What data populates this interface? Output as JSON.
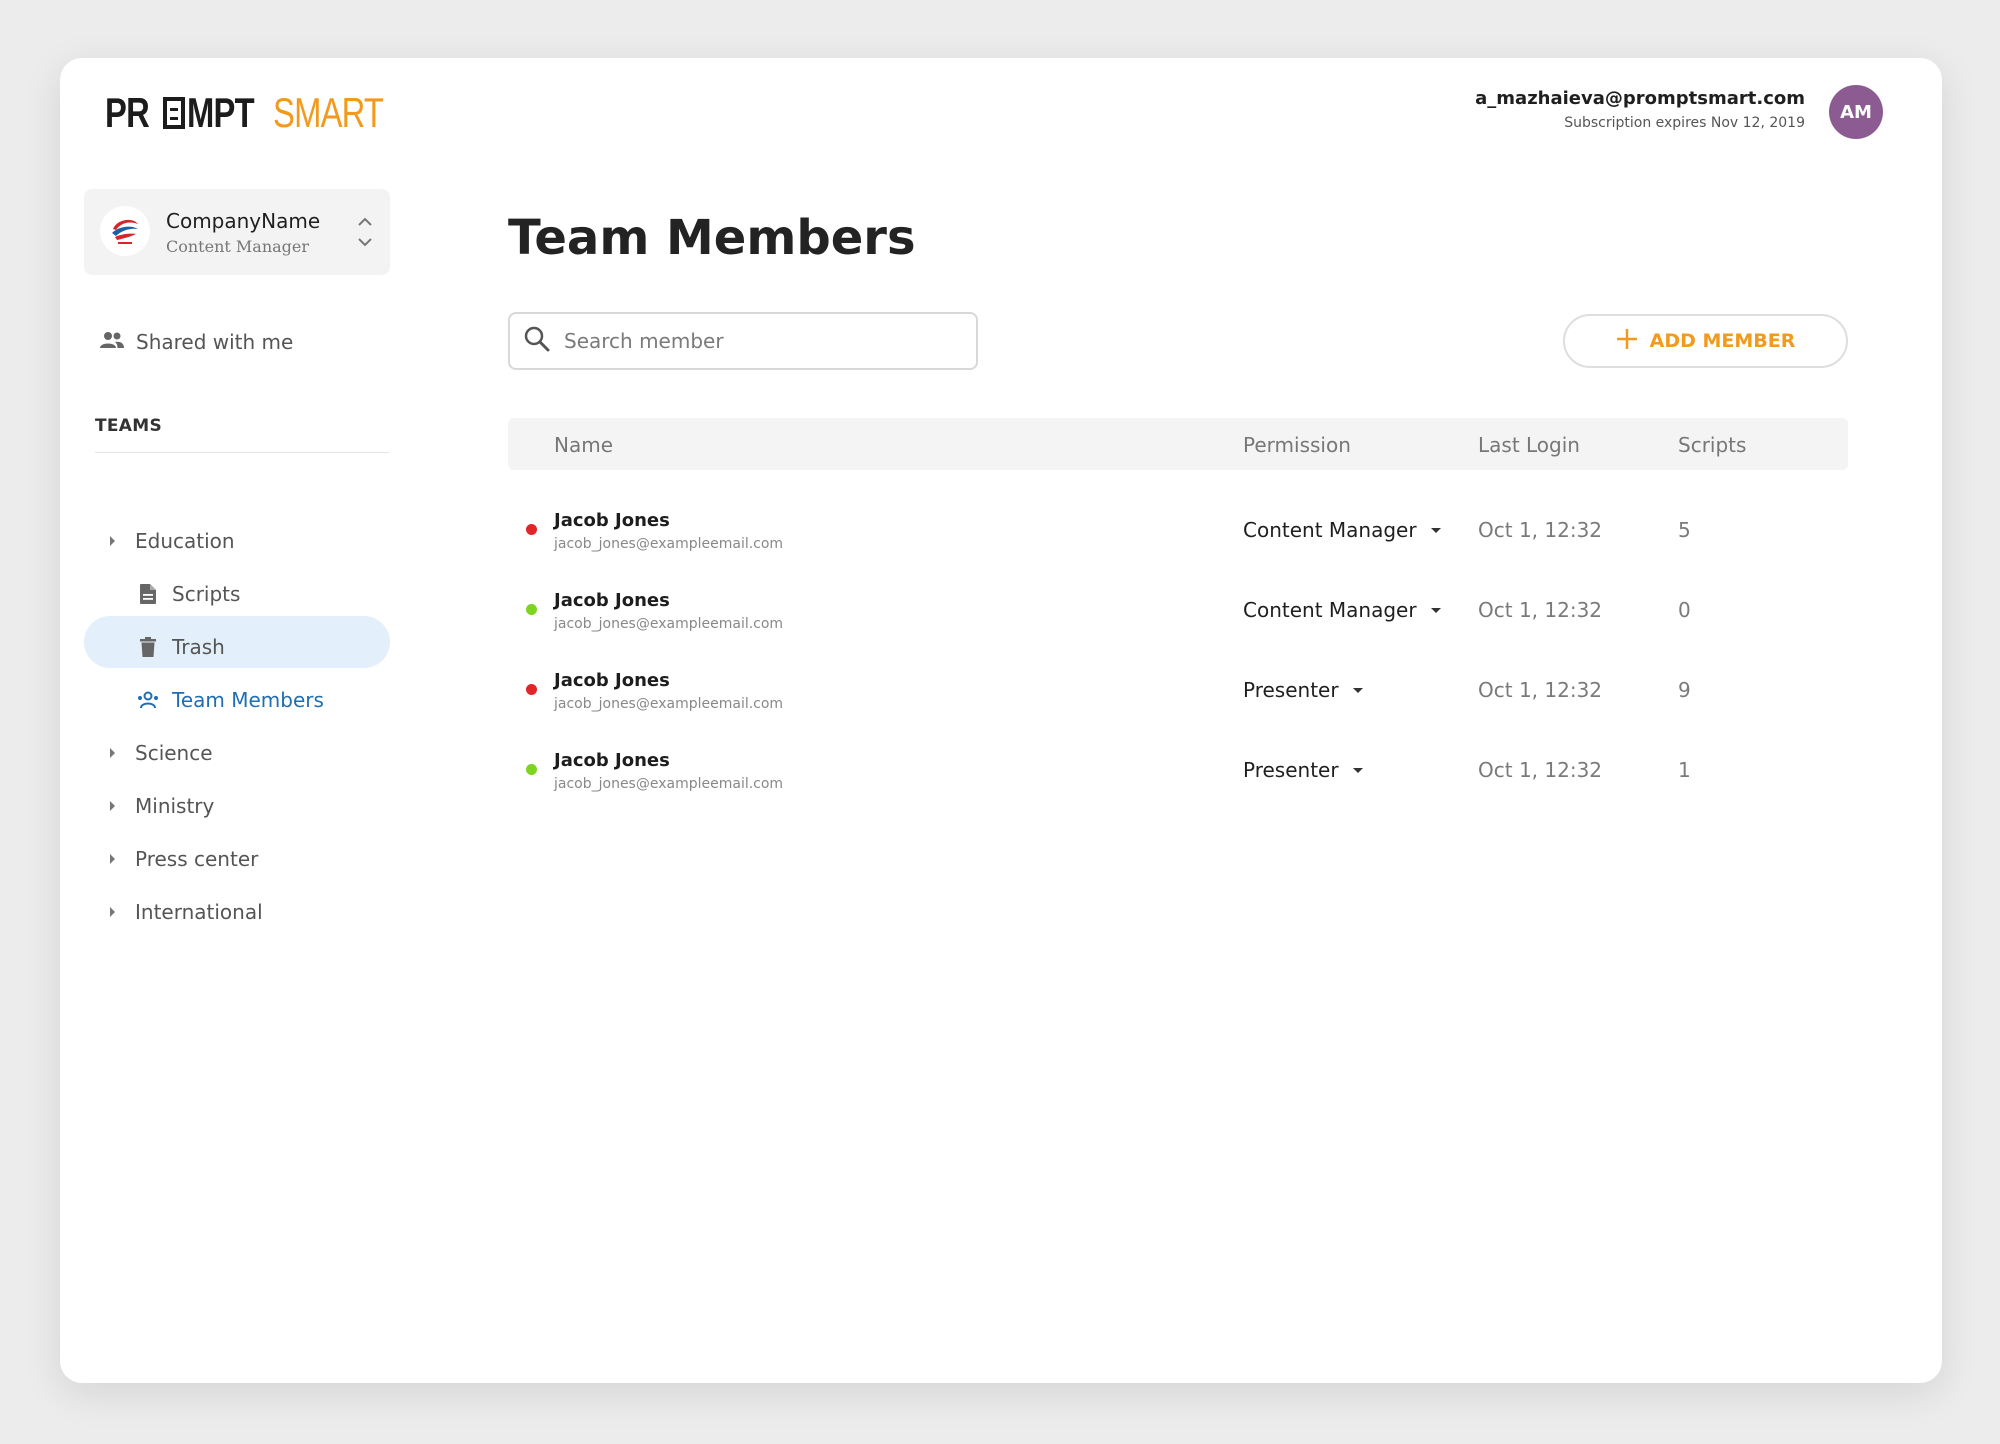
{
  "logo": {
    "part1": "PR",
    "part2": "MPT",
    "part3": "SMART"
  },
  "user": {
    "email": "a_mazhaieva@promptsmart.com",
    "subscription": "Subscription expires Nov 12, 2019",
    "initials": "AM",
    "avatar_color": "#8b5b91"
  },
  "company": {
    "name": "CompanyName",
    "role": "Content Manager"
  },
  "sidebar": {
    "shared_label": "Shared with me",
    "teams_title": "TEAMS",
    "teams": [
      {
        "label": "Education"
      },
      {
        "label": "Scripts"
      },
      {
        "label": "Trash"
      },
      {
        "label": "Team Members"
      },
      {
        "label": "Science"
      },
      {
        "label": "Ministry"
      },
      {
        "label": "Press center"
      },
      {
        "label": "International"
      }
    ]
  },
  "main": {
    "title": "Team Members",
    "search_placeholder": "Search member",
    "add_label": "ADD MEMBER",
    "columns": {
      "name": "Name",
      "permission": "Permission",
      "last_login": "Last Login",
      "scripts": "Scripts"
    },
    "members": [
      {
        "name": "Jacob Jones",
        "email": "jacob_jones@exampleemail.com",
        "permission": "Content Manager",
        "last_login": "Oct 1, 12:32",
        "scripts": "5",
        "status_color": "#e0262b"
      },
      {
        "name": "Jacob Jones",
        "email": "jacob_jones@exampleemail.com",
        "permission": "Content Manager",
        "last_login": "Oct 1, 12:32",
        "scripts": "0",
        "status_color": "#7ed321"
      },
      {
        "name": "Jacob Jones",
        "email": "jacob_jones@exampleemail.com",
        "permission": "Presenter",
        "last_login": "Oct 1, 12:32",
        "scripts": "9",
        "status_color": "#e0262b"
      },
      {
        "name": "Jacob Jones",
        "email": "jacob_jones@exampleemail.com",
        "permission": "Presenter",
        "last_login": "Oct 1, 12:32",
        "scripts": "1",
        "status_color": "#7ed321"
      }
    ]
  },
  "colors": {
    "accent": "#f29a1d",
    "active_bg": "#e3f0fb",
    "active_text": "#1f6eb3"
  }
}
